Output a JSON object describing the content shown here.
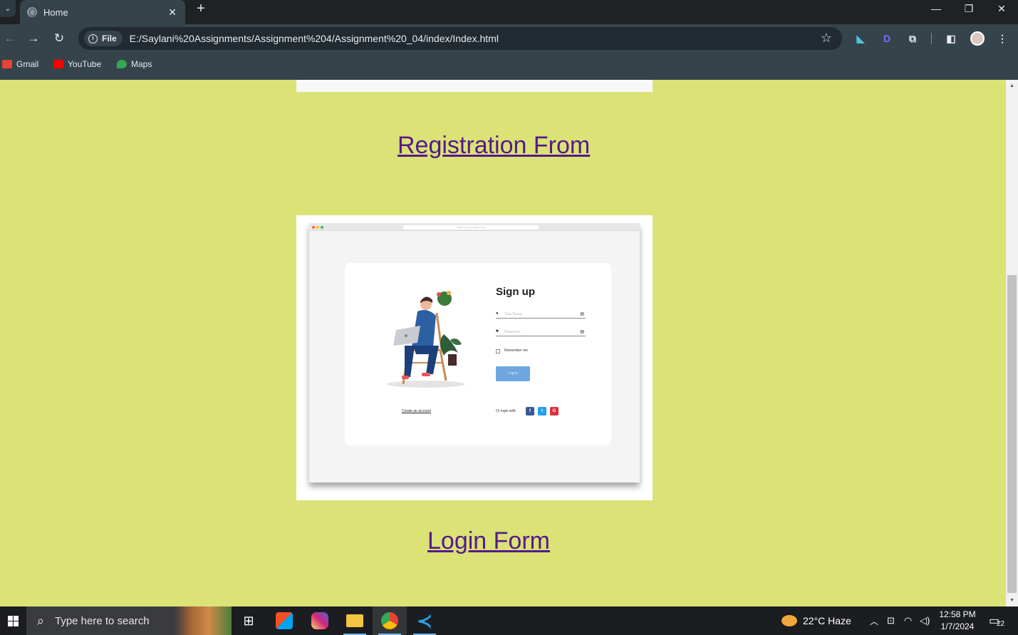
{
  "browser": {
    "tab": {
      "title": "Home",
      "close": "✕"
    },
    "new_tab": "+",
    "window_controls": {
      "minimize": "—",
      "restore": "❐",
      "close": "✕"
    },
    "site_chip": "File",
    "url": "E:/Saylani%20Assignments/Assignment%204/Assignment%20_04/index/Index.html",
    "bookmarks": [
      {
        "label": "Gmail",
        "icon": "gmail-icon",
        "color": "#ea4335"
      },
      {
        "label": "YouTube",
        "icon": "youtube-icon",
        "color": "#ff0000"
      },
      {
        "label": "Maps",
        "icon": "maps-icon",
        "color": "#34a853"
      }
    ]
  },
  "page": {
    "background": "#dbe276",
    "registration_link": "Registration From",
    "login_link": "Login Form",
    "screenshot": {
      "url_text": "Search or enter website name",
      "title": "Sign up",
      "name_placeholder": "Your Name",
      "password_placeholder": "Password",
      "remember": "Remember me",
      "button": "Log in",
      "create_account": "Create an account",
      "or_login": "Or login with",
      "social": [
        "f",
        "t",
        "G"
      ]
    }
  },
  "taskbar": {
    "search_placeholder": "Type here to search",
    "weather": "22°C  Haze",
    "time": "12:58 PM",
    "date": "1/7/2024",
    "notifications": "22"
  }
}
